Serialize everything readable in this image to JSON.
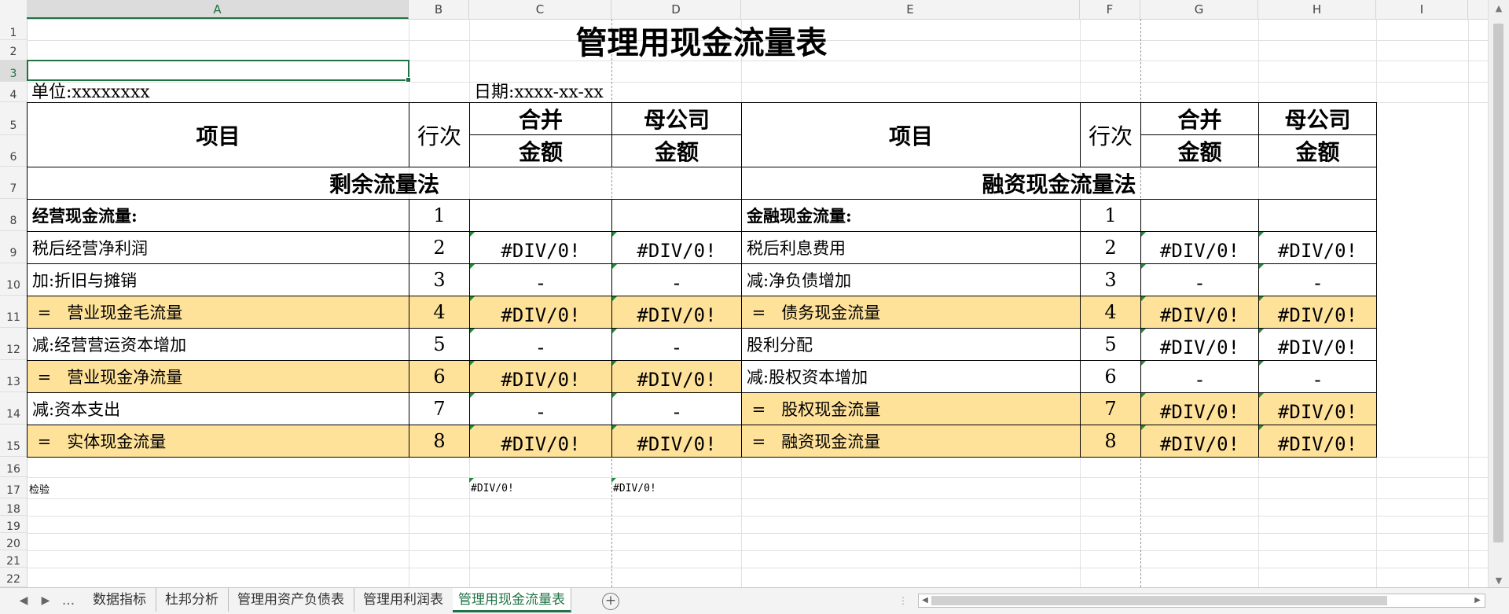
{
  "columns": [
    "A",
    "B",
    "C",
    "D",
    "E",
    "F",
    "G",
    "H",
    "I"
  ],
  "selected_column": "A",
  "rows": [
    "1",
    "2",
    "3",
    "4",
    "5",
    "6",
    "7",
    "8",
    "9",
    "10",
    "11",
    "12",
    "13",
    "14",
    "15",
    "16",
    "17",
    "18",
    "19",
    "20",
    "21",
    "22"
  ],
  "selected_row": "3",
  "sheet": {
    "title": "管理用现金流量表",
    "unit": "单位:xxxxxxxx",
    "date": "日期:xxxx-xx-xx",
    "headers": {
      "item": "项目",
      "line_no": "行次",
      "consolidated": "合并",
      "parent": "母公司",
      "amount": "金额"
    },
    "left": {
      "section": "剩余流量法",
      "rows": [
        {
          "label": "经营现金流量:",
          "line": "1",
          "c": "",
          "d": "",
          "bold": true,
          "highlight": false
        },
        {
          "label": "税后经营净利润",
          "line": "2",
          "c": "#DIV/0!",
          "d": "#DIV/0!",
          "bold": false,
          "highlight": false
        },
        {
          "label": "加:折旧与摊销",
          "line": "3",
          "c": "-",
          "d": "-",
          "bold": false,
          "highlight": false
        },
        {
          "label": " =   营业现金毛流量",
          "line": "4",
          "c": "#DIV/0!",
          "d": "#DIV/0!",
          "bold": false,
          "highlight": true
        },
        {
          "label": "减:经营营运资本增加",
          "line": "5",
          "c": "-",
          "d": "-",
          "bold": false,
          "highlight": false
        },
        {
          "label": " =   营业现金净流量",
          "line": "6",
          "c": "#DIV/0!",
          "d": "#DIV/0!",
          "bold": false,
          "highlight": true
        },
        {
          "label": "减:资本支出",
          "line": "7",
          "c": "-",
          "d": "-",
          "bold": false,
          "highlight": false
        },
        {
          "label": " =   实体现金流量",
          "line": "8",
          "c": "#DIV/0!",
          "d": "#DIV/0!",
          "bold": false,
          "highlight": true
        }
      ]
    },
    "right": {
      "section": "融资现金流量法",
      "rows": [
        {
          "label": "金融现金流量:",
          "line": "1",
          "g": "",
          "h": "",
          "bold": true,
          "highlight": false
        },
        {
          "label": "税后利息费用",
          "line": "2",
          "g": "#DIV/0!",
          "h": "#DIV/0!",
          "bold": false,
          "highlight": false
        },
        {
          "label": "减:净负债增加",
          "line": "3",
          "g": "-",
          "h": "-",
          "bold": false,
          "highlight": false
        },
        {
          "label": " =   债务现金流量",
          "line": "4",
          "g": "#DIV/0!",
          "h": "#DIV/0!",
          "bold": false,
          "highlight": true
        },
        {
          "label": "股利分配",
          "line": "5",
          "g": "#DIV/0!",
          "h": "#DIV/0!",
          "bold": false,
          "highlight": false
        },
        {
          "label": "减:股权资本增加",
          "line": "6",
          "g": "-",
          "h": "-",
          "bold": false,
          "highlight": false
        },
        {
          "label": " =   股权现金流量",
          "line": "7",
          "g": "#DIV/0!",
          "h": "#DIV/0!",
          "bold": false,
          "highlight": true
        },
        {
          "label": " =   融资现金流量",
          "line": "8",
          "g": "#DIV/0!",
          "h": "#DIV/0!",
          "bold": false,
          "highlight": true
        }
      ]
    },
    "check": {
      "label": "检验",
      "c": "#DIV/0!",
      "d": "#DIV/0!"
    }
  },
  "tabs": {
    "more": "...",
    "items": [
      "数据指标",
      "杜邦分析",
      "管理用资产负债表",
      "管理用利润表",
      "管理用现金流量表"
    ],
    "active_index": 4
  },
  "colors": {
    "highlight": "#ffe29a",
    "accent": "#1f7244",
    "error_marker": "#1f8a3a"
  }
}
